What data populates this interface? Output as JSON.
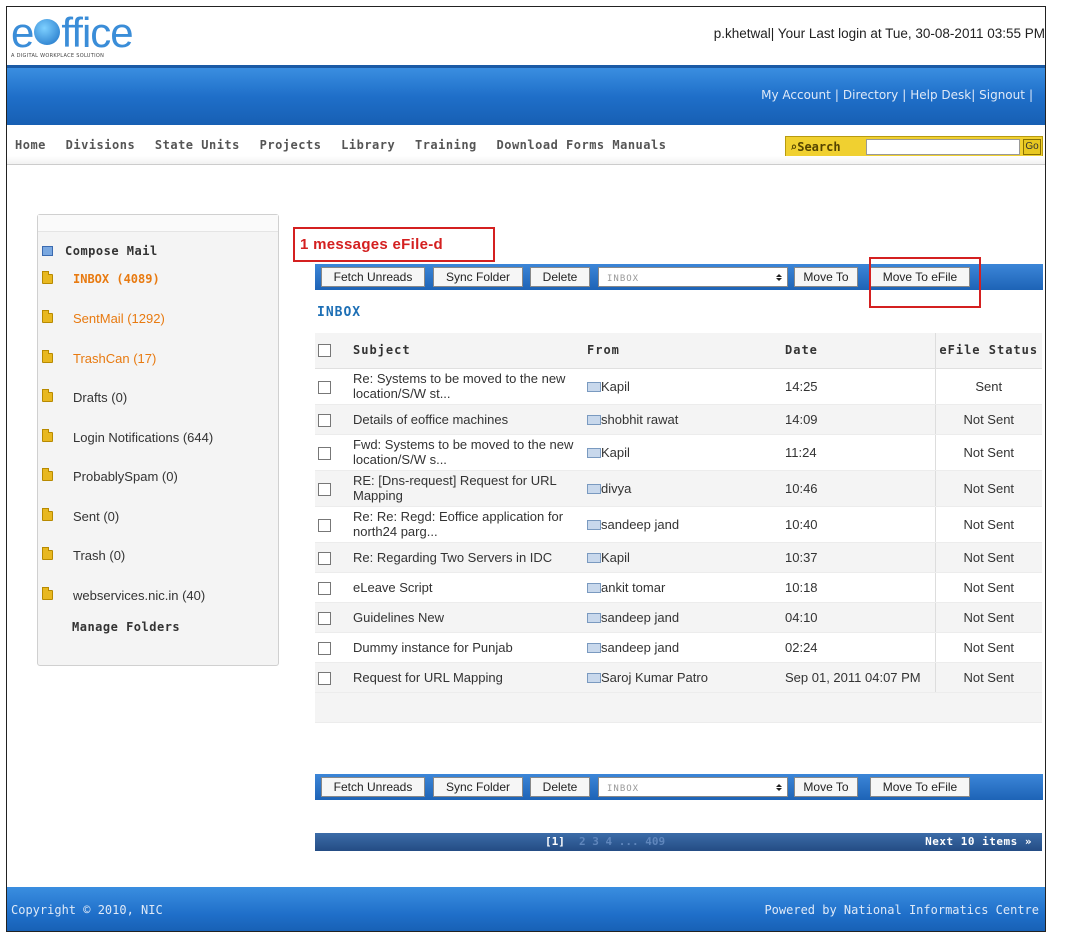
{
  "header": {
    "logo_text": "eOffice",
    "logo_tagline": "A DIGITAL WORKPLACE SOLUTION",
    "login_info": "p.khetwal| Your Last login at Tue, 30-08-2011 03:55 PM"
  },
  "top_links": {
    "my_account": "My Account",
    "directory": "Directory",
    "help_desk": "Help Desk|",
    "signout": "Signout"
  },
  "menu": {
    "items": [
      "Home",
      "Divisions",
      "State Units",
      "Projects",
      "Library",
      "Training",
      "Download Forms Manuals"
    ],
    "search_label": "Search",
    "search_value": "",
    "go_label": "Go"
  },
  "sidebar": {
    "compose": "Compose Mail",
    "folders": [
      {
        "label": "INBOX (4089)"
      },
      {
        "label": "SentMail (1292)"
      },
      {
        "label": "TrashCan (17)"
      },
      {
        "label": "Drafts (0)"
      },
      {
        "label": "Login Notifications (644)"
      },
      {
        "label": "ProbablySpam (0)"
      },
      {
        "label": "Sent (0)"
      },
      {
        "label": "Trash (0)"
      },
      {
        "label": "webservices.nic.in (40)"
      }
    ],
    "manage": "Manage Folders"
  },
  "main": {
    "notice": "1 messages eFile-d",
    "toolbar": {
      "fetch": "Fetch Unreads",
      "sync": "Sync Folder",
      "delete": "Delete",
      "folder_select": "INBOX",
      "move_to": "Move To",
      "move_to_efile": "Move To eFile"
    },
    "folder_title": "INBOX",
    "columns": {
      "subject": "Subject",
      "from": "From",
      "date": "Date",
      "status": "eFile Status"
    },
    "rows": [
      {
        "subject": "Re: Systems to be moved to the new location/S/W st...",
        "from": "Kapil",
        "date": "14:25",
        "status": "Sent"
      },
      {
        "subject": "Details of eoffice machines",
        "from": "shobhit rawat",
        "date": "14:09",
        "status": "Not Sent"
      },
      {
        "subject": "Fwd: Systems to be moved to the new location/S/W s...",
        "from": "Kapil",
        "date": "11:24",
        "status": "Not Sent"
      },
      {
        "subject": "RE: [Dns-request] Request for URL Mapping",
        "from": "divya",
        "date": "10:46",
        "status": "Not Sent"
      },
      {
        "subject": "Re: Re: Regd: Eoffice application for north24 parg...",
        "from": "sandeep jand",
        "date": "10:40",
        "status": "Not Sent"
      },
      {
        "subject": "Re: Regarding Two Servers in IDC",
        "from": "Kapil",
        "date": "10:37",
        "status": "Not Sent"
      },
      {
        "subject": "eLeave Script",
        "from": "ankit tomar",
        "date": "10:18",
        "status": "Not Sent"
      },
      {
        "subject": "Guidelines New",
        "from": "sandeep jand",
        "date": "04:10",
        "status": "Not Sent"
      },
      {
        "subject": "Dummy instance for Punjab",
        "from": "sandeep jand",
        "date": "02:24",
        "status": "Not Sent"
      },
      {
        "subject": "Request for URL Mapping",
        "from": "Saroj Kumar Patro",
        "date": "Sep 01, 2011 04:07 PM",
        "status": "Not Sent"
      }
    ],
    "pager": {
      "current": "[1]",
      "more": "2 3 4 ... 409",
      "next": "Next 10 items »"
    }
  },
  "footer": {
    "copyright": "Copyright © 2010, NIC",
    "powered": "Powered by National Informatics Centre"
  },
  "colors": {
    "brand_blue": "#1f6fc9",
    "accent_orange": "#e87a10",
    "highlight_red": "#d42020",
    "search_yellow": "#f0d030"
  }
}
